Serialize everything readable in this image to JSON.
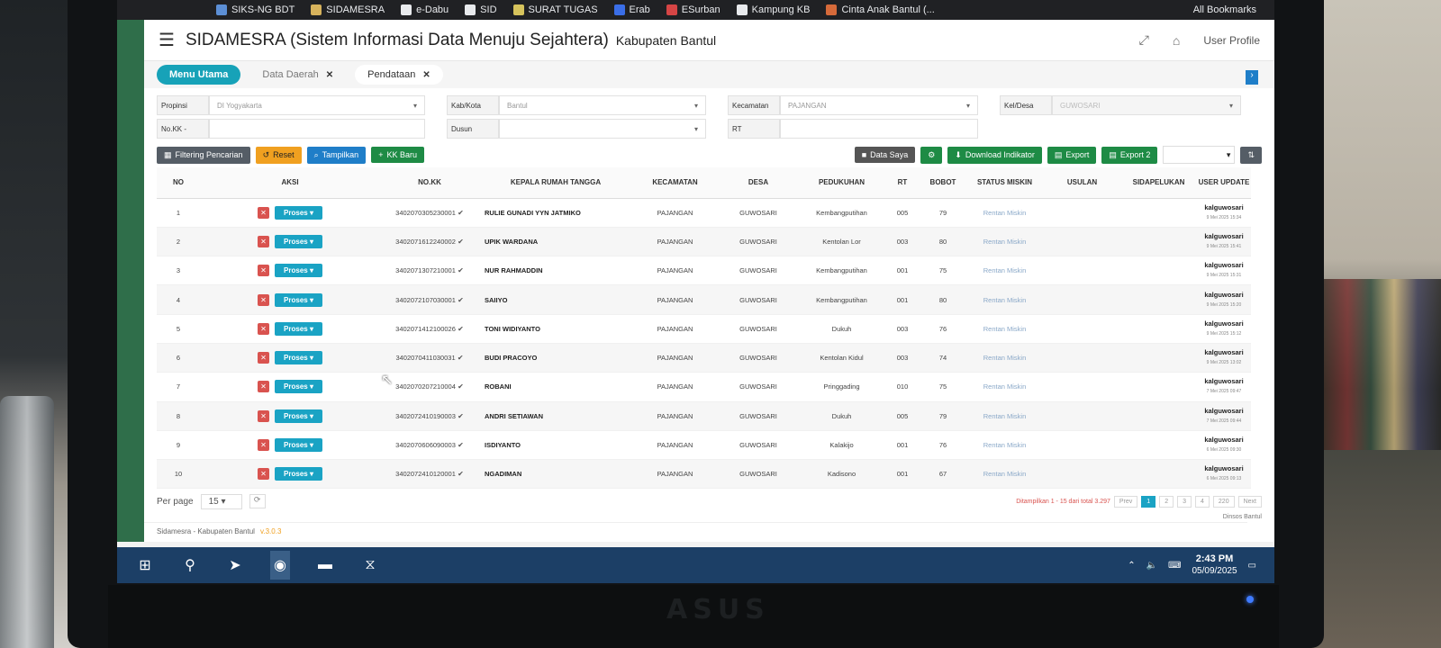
{
  "browser": {
    "bookmarks": [
      {
        "label": "SIKS-NG BDT",
        "color": "#5c8fd6"
      },
      {
        "label": "SIDAMESRA",
        "color": "#d6b25c"
      },
      {
        "label": "e-Dabu",
        "color": "#e8eaed"
      },
      {
        "label": "SID",
        "color": "#e8eaed"
      },
      {
        "label": "SURAT TUGAS",
        "color": "#d6c35c"
      },
      {
        "label": "Erab",
        "color": "#3a6ee8"
      },
      {
        "label": "ESurban",
        "color": "#d64545"
      },
      {
        "label": "Kampung KB",
        "color": "#e8eaed"
      },
      {
        "label": "Cinta Anak Bantul (...",
        "color": "#d66a3a"
      }
    ],
    "all_bookmarks": "All Bookmarks"
  },
  "header": {
    "menu_icon": "hamburger-icon",
    "title": "SIDAMESRA (Sistem Informasi Data Menuju Sejahtera)",
    "subtitle": "Kabupaten Bantul",
    "user_profile": "User Profile"
  },
  "tabs": [
    {
      "label": "Menu Utama",
      "style": "active",
      "closable": false
    },
    {
      "label": "Data Daerah",
      "style": "plain",
      "closable": true
    },
    {
      "label": "Pendataan",
      "style": "light",
      "closable": true
    }
  ],
  "filters": {
    "provinsi": {
      "label": "Propinsi",
      "value": "DI Yogyakarta"
    },
    "kabkota": {
      "label": "Kab/Kota",
      "value": "Bantul"
    },
    "kecamatan": {
      "label": "Kecamatan",
      "value": "PAJANGAN"
    },
    "keldesa": {
      "label": "Kel/Desa",
      "value": "GUWOSARI"
    },
    "nokk": {
      "label": "No.KK -",
      "value": ""
    },
    "dusun": {
      "label": "Dusun",
      "value": ""
    },
    "rt": {
      "label": "RT",
      "value": ""
    }
  },
  "actions": {
    "filtering": "Filtering Pencarian",
    "reset": "Reset",
    "tampilkan": "Tampilkan",
    "kk_baru": "KK Baru",
    "data_saya": "Data Saya",
    "download": "Download Indikator",
    "export": "Export",
    "export2": "Export 2"
  },
  "table": {
    "headers": [
      "NO",
      "AKSI",
      "NO.KK",
      "KEPALA RUMAH TANGGA",
      "KECAMATAN",
      "DESA",
      "PEDUKUHAN",
      "RT",
      "BOBOT",
      "STATUS MISKIN",
      "USULAN",
      "SIDAPELUKAN",
      "USER UPDATE"
    ],
    "proses_label": "Proses",
    "rows": [
      {
        "no": "1",
        "nokk": "3402070305230001",
        "nama": "RULIE GUNADI YYN JATMIKO",
        "kec": "PAJANGAN",
        "desa": "GUWOSARI",
        "dukuh": "Kembangputihan",
        "rt": "005",
        "bobot": "79",
        "status": "Rentan Miskin",
        "user": "kalguwosari",
        "waktu": "9 Mei 2025 15:34"
      },
      {
        "no": "2",
        "nokk": "3402071612240002",
        "nama": "UPIK WARDANA",
        "kec": "PAJANGAN",
        "desa": "GUWOSARI",
        "dukuh": "Kentolan Lor",
        "rt": "003",
        "bobot": "80",
        "status": "Rentan Miskin",
        "user": "kalguwosari",
        "waktu": "9 Mei 2025 15:41"
      },
      {
        "no": "3",
        "nokk": "3402071307210001",
        "nama": "NUR RAHMADDIN",
        "kec": "PAJANGAN",
        "desa": "GUWOSARI",
        "dukuh": "Kembangputihan",
        "rt": "001",
        "bobot": "75",
        "status": "Rentan Miskin",
        "user": "kalguwosari",
        "waktu": "9 Mei 2025 15:31"
      },
      {
        "no": "4",
        "nokk": "3402072107030001",
        "nama": "SAIIYO",
        "kec": "PAJANGAN",
        "desa": "GUWOSARI",
        "dukuh": "Kembangputihan",
        "rt": "001",
        "bobot": "80",
        "status": "Rentan Miskin",
        "user": "kalguwosari",
        "waktu": "9 Mei 2025 15:20"
      },
      {
        "no": "5",
        "nokk": "3402071412100026",
        "nama": "TONI WIDIYANTO",
        "kec": "PAJANGAN",
        "desa": "GUWOSARI",
        "dukuh": "Dukuh",
        "rt": "003",
        "bobot": "76",
        "status": "Rentan Miskin",
        "user": "kalguwosari",
        "waktu": "9 Mei 2025 15:12"
      },
      {
        "no": "6",
        "nokk": "3402070411030031",
        "nama": "BUDI PRACOYO",
        "kec": "PAJANGAN",
        "desa": "GUWOSARI",
        "dukuh": "Kentolan Kidul",
        "rt": "003",
        "bobot": "74",
        "status": "Rentan Miskin",
        "user": "kalguwosari",
        "waktu": "9 Mei 2025 13:02"
      },
      {
        "no": "7",
        "nokk": "3402070207210004",
        "nama": "ROBANI",
        "kec": "PAJANGAN",
        "desa": "GUWOSARI",
        "dukuh": "Pringgading",
        "rt": "010",
        "bobot": "75",
        "status": "Rentan Miskin",
        "user": "kalguwosari",
        "waktu": "7 Mei 2025 09:47"
      },
      {
        "no": "8",
        "nokk": "3402072410190003",
        "nama": "ANDRI SETIAWAN",
        "kec": "PAJANGAN",
        "desa": "GUWOSARI",
        "dukuh": "Dukuh",
        "rt": "005",
        "bobot": "79",
        "status": "Rentan Miskin",
        "user": "kalguwosari",
        "waktu": "7 Mei 2025 09:44"
      },
      {
        "no": "9",
        "nokk": "3402070606090003",
        "nama": "ISDIYANTO",
        "kec": "PAJANGAN",
        "desa": "GUWOSARI",
        "dukuh": "Kalakijo",
        "rt": "001",
        "bobot": "76",
        "status": "Rentan Miskin",
        "user": "kalguwosari",
        "waktu": "6 Mei 2025 09:30"
      },
      {
        "no": "10",
        "nokk": "3402072410120001",
        "nama": "NGADIMAN",
        "kec": "PAJANGAN",
        "desa": "GUWOSARI",
        "dukuh": "Kadisono",
        "rt": "001",
        "bobot": "67",
        "status": "Rentan Miskin",
        "user": "kalguwosari",
        "waktu": "6 Mei 2025 09:13"
      }
    ]
  },
  "footer": {
    "per_page_label": "Per page",
    "per_page_value": "15",
    "summary": "Ditampilkan 1 - 15 dari total 3.297",
    "prev": "Prev",
    "pages": [
      "1",
      "2",
      "3",
      "4"
    ],
    "last": "220",
    "next": "Next",
    "dinsos": "Dinsos Bantul",
    "app_footer": "Sidamesra - Kabupaten Bantul",
    "version": "v.3.0.3"
  },
  "taskbar": {
    "time": "2:43 PM",
    "date": "05/09/2025",
    "icons": [
      "windows-start-icon",
      "search-icon",
      "telegram-icon",
      "chrome-icon",
      "file-explorer-icon",
      "app-icon"
    ]
  }
}
